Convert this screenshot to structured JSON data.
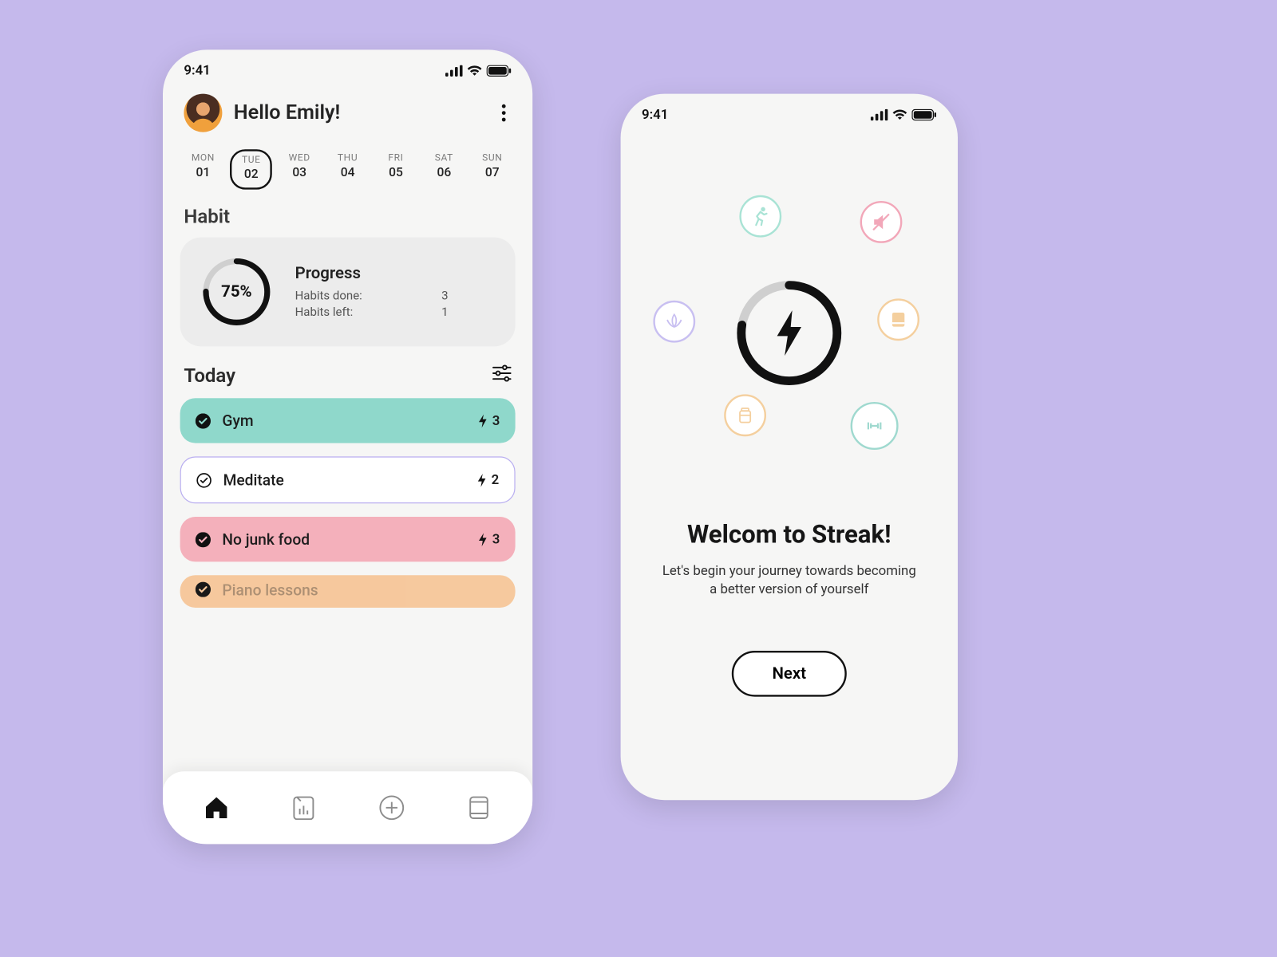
{
  "status": {
    "time": "9:41"
  },
  "header": {
    "greeting": "Hello Emily!"
  },
  "week": [
    {
      "dow": "MON",
      "num": "01",
      "selected": false
    },
    {
      "dow": "TUE",
      "num": "02",
      "selected": true
    },
    {
      "dow": "WED",
      "num": "03",
      "selected": false
    },
    {
      "dow": "THU",
      "num": "04",
      "selected": false
    },
    {
      "dow": "FRI",
      "num": "05",
      "selected": false
    },
    {
      "dow": "SAT",
      "num": "06",
      "selected": false
    },
    {
      "dow": "SUN",
      "num": "07",
      "selected": false
    }
  ],
  "habit": {
    "title": "Habit",
    "progress": {
      "percent_label": "75%",
      "percent": 75,
      "heading": "Progress",
      "done_label": "Habits done:",
      "done_count": "3",
      "left_label": "Habits left:",
      "left_count": "1"
    }
  },
  "today": {
    "title": "Today",
    "items": [
      {
        "name": "Gym",
        "streak": "3",
        "checked": true,
        "color": "gym"
      },
      {
        "name": "Meditate",
        "streak": "2",
        "checked": false,
        "color": "med"
      },
      {
        "name": "No junk food",
        "streak": "3",
        "checked": true,
        "color": "junk"
      },
      {
        "name": "Piano lessons",
        "streak": "",
        "checked": true,
        "color": "piano"
      }
    ]
  },
  "tabbar": {
    "icons": [
      "home-icon",
      "stats-icon",
      "add-icon",
      "journal-icon"
    ]
  },
  "onboard": {
    "title": "Welcom to Streak!",
    "subtitle": "Let's begin your journey towards becoming a better version of yourself",
    "next": "Next"
  }
}
